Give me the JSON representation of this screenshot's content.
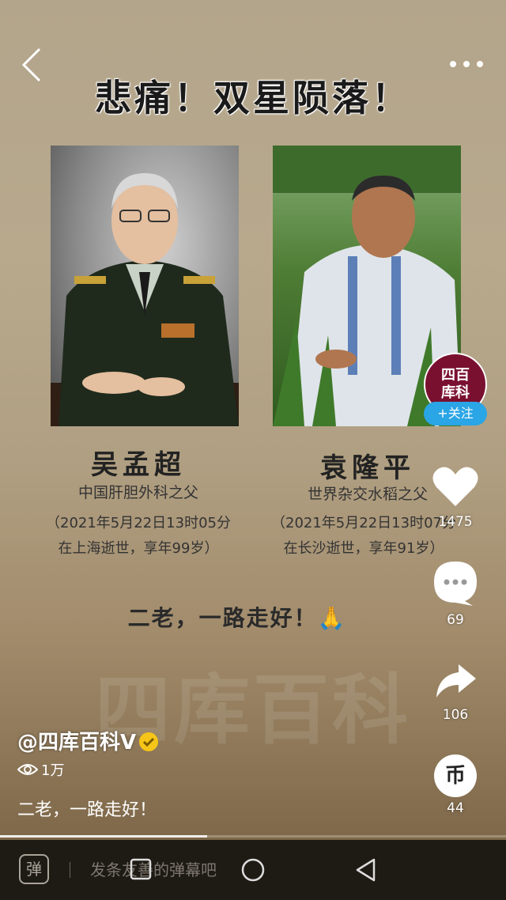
{
  "video": {
    "headline": "悲痛！双星陨落！",
    "watermark": "四库百科",
    "left_person": {
      "name": "吴孟超",
      "role": "中国肝胆外科之父",
      "detail_line1": "（2021年5月22日13时05分",
      "detail_line2": "在上海逝世，享年99岁）"
    },
    "right_person": {
      "name": "袁隆平",
      "role": "世界杂交水稻之父",
      "detail_line1": "（2021年5月22日13时07分",
      "detail_line2": "在长沙逝世，享年91岁）"
    },
    "farewell": "二老，一路走好！🙏"
  },
  "creator": {
    "avatar_text_line1": "四百",
    "avatar_text_line2": "库科",
    "follow_label": "+关注",
    "handle": "@四库百科V",
    "views": "1万",
    "caption": "二老，一路走好！"
  },
  "actions": {
    "likes": "1475",
    "comments": "69",
    "shares": "106",
    "coins": "44",
    "coin_glyph": "币"
  },
  "bottom_bar": {
    "danmaku_placeholder": "发条友善的弹幕吧",
    "danmaku_icon_glyph": "弹"
  },
  "progress_fraction": 0.41,
  "icons": [
    "back-icon",
    "more-icon",
    "heart-icon",
    "comment-icon",
    "share-icon",
    "coin-icon",
    "eye-icon",
    "verified-icon",
    "danmaku-icon",
    "nav-recents-icon",
    "nav-home-icon",
    "nav-back-icon"
  ],
  "colors": {
    "follow": "#2aa5e6",
    "avatar_bg": "#7a1030",
    "verified": "#f5c518"
  }
}
